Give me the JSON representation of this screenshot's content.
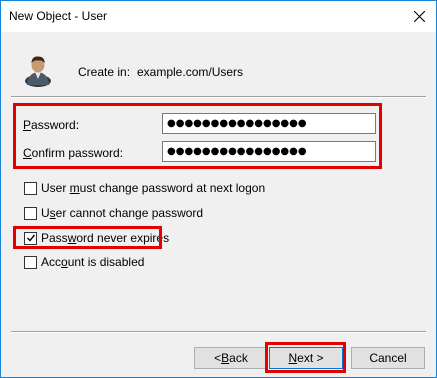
{
  "window": {
    "title": "New Object - User"
  },
  "header": {
    "create_in_label": "Create in:",
    "create_in_value": "example.com/Users"
  },
  "fields": {
    "password": {
      "label_pre": "",
      "label_key": "P",
      "label_post": "assword:",
      "value": "●●●●●●●●●●●●●●●●"
    },
    "confirm": {
      "label_pre": "",
      "label_key": "C",
      "label_post": "onfirm password:",
      "value": "●●●●●●●●●●●●●●●●"
    }
  },
  "options": [
    {
      "pre": "User ",
      "key": "m",
      "post": "ust change password at next logon",
      "checked": false
    },
    {
      "pre": "U",
      "key": "s",
      "post": "er cannot change password",
      "checked": false
    },
    {
      "pre": "Pass",
      "key": "w",
      "post": "ord never expires",
      "checked": true
    },
    {
      "pre": "Acc",
      "key": "o",
      "post": "unt is disabled",
      "checked": false
    }
  ],
  "buttons": {
    "back": {
      "pre": "< ",
      "key": "B",
      "post": "ack"
    },
    "next": {
      "pre": "",
      "key": "N",
      "post": "ext >"
    },
    "cancel": {
      "label": "Cancel"
    }
  },
  "icons": {
    "close": "close-icon",
    "user": "user-icon",
    "check": "checkmark-icon"
  },
  "colors": {
    "highlight": "#e30000",
    "accent": "#0078d7"
  }
}
